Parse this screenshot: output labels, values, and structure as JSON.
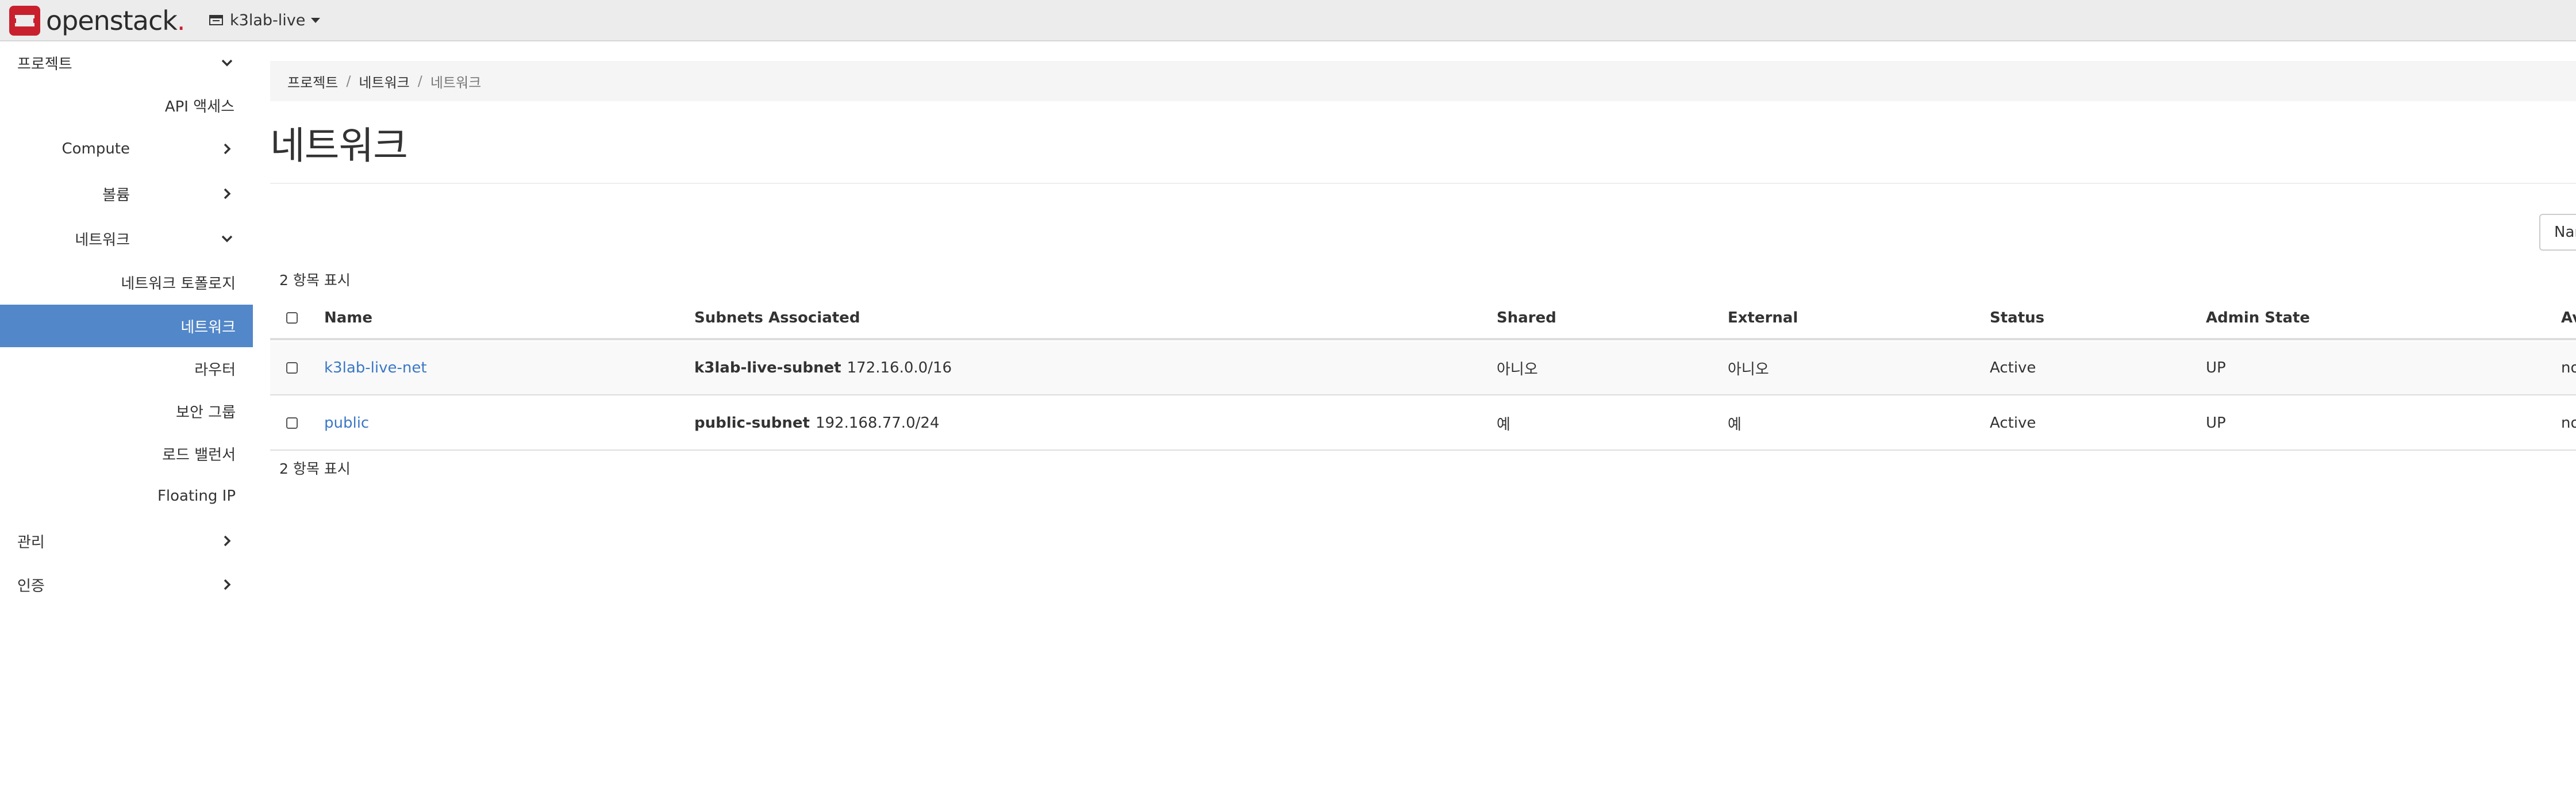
{
  "topbar": {
    "brand": "openstack",
    "brand_dot": ".",
    "project": "k3lab-live"
  },
  "sidebar": {
    "items": [
      {
        "label": "프로젝트"
      },
      {
        "label": "API 액세스"
      },
      {
        "label": "Compute"
      },
      {
        "label": "볼륨"
      },
      {
        "label": "네트워크"
      },
      {
        "label": "네트워크 토폴로지"
      },
      {
        "label": "네트워크"
      },
      {
        "label": "라우터"
      },
      {
        "label": "보안 그룹"
      },
      {
        "label": "로드 밸런서"
      },
      {
        "label": "Floating IP"
      },
      {
        "label": "관리"
      },
      {
        "label": "인증"
      }
    ]
  },
  "breadcrumb": [
    "프로젝트",
    "네트워크",
    "네트워크"
  ],
  "page_title": "네트워크",
  "filter": {
    "value": "Nar"
  },
  "count_top": "2 항목 표시",
  "count_bottom": "2 항목 표시",
  "table": {
    "headers": {
      "name": "Name",
      "subnets": "Subnets Associated",
      "shared": "Shared",
      "external": "External",
      "status": "Status",
      "admin_state": "Admin State",
      "av": "Av"
    },
    "rows": [
      {
        "name": "k3lab-live-net",
        "subnet_name": "k3lab-live-subnet",
        "subnet_cidr": "172.16.0.0/16",
        "shared": "아니오",
        "external": "아니오",
        "status": "Active",
        "admin_state": "UP",
        "av": "no"
      },
      {
        "name": "public",
        "subnet_name": "public-subnet",
        "subnet_cidr": "192.168.77.0/24",
        "shared": "예",
        "external": "예",
        "status": "Active",
        "admin_state": "UP",
        "av": "no"
      }
    ]
  },
  "colors": {
    "accent": "#5287c9",
    "link": "#3b78c4",
    "brand_red": "#c8202d"
  }
}
